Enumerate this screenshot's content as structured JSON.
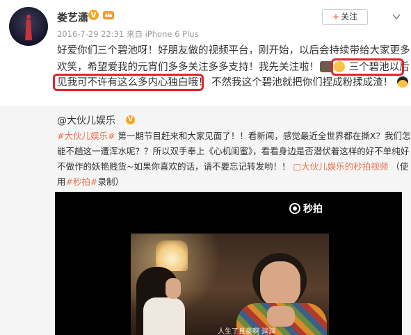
{
  "post": {
    "author": "娄艺潇",
    "verified_badge": "V",
    "meta": "2016-7-29 22:31 来自 iPhone 6 Plus",
    "follow_plus": "+",
    "follow_label": "关注",
    "text_line1": "好爱你们三个碧池呀！好朋友做的视频平台，刚开始，以后会持续带给大家更多",
    "text_line2": "欢笑，希望爱我的元宵们多多关注多多支持！我先关注啦！",
    "text_line2_highlight": "三个碧池以后",
    "text_line3_highlight": "见我可不许有这么多内心独白哦！",
    "text_line3_rest": "不然我这个碧池就把你们捏成粉揉成渣！"
  },
  "repost": {
    "author_at": "@",
    "author": "大伙儿娱乐",
    "verified_badge": "V",
    "line1_tag": "#大伙儿娱乐#",
    "line1_rest": " 第一期节目赶来和大家见面了！！看新闻，感觉最近全世界都在撕X？我们怎么",
    "line2": "能不趟这一遭浑水呢？？所以双手奉上《心机闺蜜》，看看身边是否潜伏着这样的好不单纯好",
    "line3_a": "不做作的妖艳贱货~如果你喜欢的话，请不要忘记转发哟！！",
    "line3_link": "大伙儿娱乐的秒拍视频",
    "line3_b": "（使",
    "line4_a": "用",
    "line4_tag": "#秒拍#",
    "line4_b": "录制）"
  },
  "video": {
    "watermark": "秒拍",
    "subtitle": "人生了县豪啊 涧涧"
  },
  "colors": {
    "link": "#eb7350",
    "highlight_border": "#e0262b",
    "verified": "#f5a623"
  },
  "icons": {
    "rank": "crown-rank-icon",
    "chevron": "chevron-down-icon",
    "emoji_people": "people-emoji-icon",
    "emoji_laugh": "laugh-emoji-icon",
    "emoji_sunglasses": "sunglasses-emoji-icon"
  }
}
